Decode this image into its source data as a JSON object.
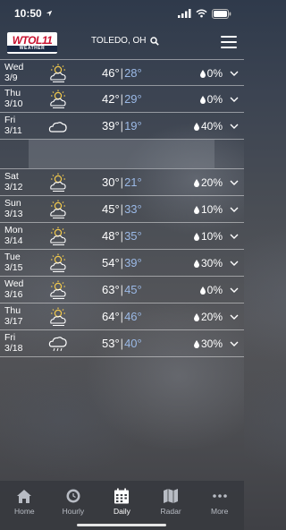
{
  "status": {
    "time": "10:50"
  },
  "header": {
    "logo_main": "WTOL11",
    "logo_sub": "WEATHER",
    "location": "TOLEDO, OH"
  },
  "days": [
    {
      "day": "Wed",
      "date": "3/9",
      "hi": "46°",
      "lo": "28°",
      "precip": "0%",
      "icon": "partly-cloudy-icon"
    },
    {
      "day": "Thu",
      "date": "3/10",
      "hi": "42°",
      "lo": "29°",
      "precip": "0%",
      "icon": "partly-cloudy-icon"
    },
    {
      "day": "Fri",
      "date": "3/11",
      "hi": "39°",
      "lo": "19°",
      "precip": "40%",
      "icon": "cloudy-icon"
    },
    {
      "day": "Sat",
      "date": "3/12",
      "hi": "30°",
      "lo": "21°",
      "precip": "20%",
      "icon": "partly-cloudy-icon"
    },
    {
      "day": "Sun",
      "date": "3/13",
      "hi": "45°",
      "lo": "33°",
      "precip": "10%",
      "icon": "partly-cloudy-icon"
    },
    {
      "day": "Mon",
      "date": "3/14",
      "hi": "48°",
      "lo": "35°",
      "precip": "10%",
      "icon": "partly-cloudy-icon"
    },
    {
      "day": "Tue",
      "date": "3/15",
      "hi": "54°",
      "lo": "39°",
      "precip": "30%",
      "icon": "partly-cloudy-icon"
    },
    {
      "day": "Wed",
      "date": "3/16",
      "hi": "63°",
      "lo": "45°",
      "precip": "0%",
      "icon": "partly-cloudy-icon"
    },
    {
      "day": "Thu",
      "date": "3/17",
      "hi": "64°",
      "lo": "46°",
      "precip": "20%",
      "icon": "partly-cloudy-icon"
    },
    {
      "day": "Fri",
      "date": "3/18",
      "hi": "53°",
      "lo": "40°",
      "precip": "30%",
      "icon": "rain-icon"
    }
  ],
  "tabs": [
    {
      "label": "Home",
      "icon": "home-icon"
    },
    {
      "label": "Hourly",
      "icon": "clock-icon"
    },
    {
      "label": "Daily",
      "icon": "calendar-icon"
    },
    {
      "label": "Radar",
      "icon": "map-icon"
    },
    {
      "label": "More",
      "icon": "more-icon"
    }
  ],
  "colors": {
    "low_temp": "#9bb9e6",
    "brand_red": "#c8102e"
  }
}
